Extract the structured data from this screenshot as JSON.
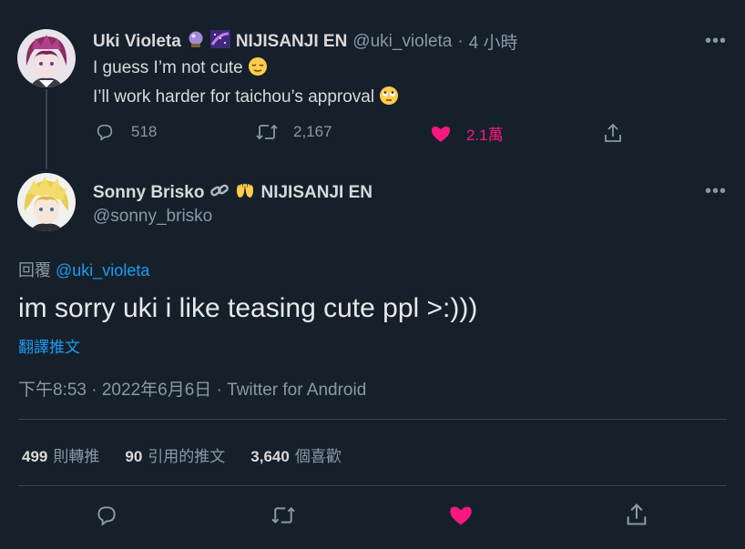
{
  "reply_tweet": {
    "display_name": "Uki Violeta",
    "affiliation": "NIJISANJI EN",
    "handle": "@uki_violeta",
    "time_ago": "4 小時",
    "line1": "I guess I’m not cute",
    "line2": "I’ll work harder for taichou’s approval",
    "reply_count": "518",
    "retweet_count": "2,167",
    "like_count": "2.1萬"
  },
  "main_tweet": {
    "display_name": "Sonny Brisko",
    "affiliation": "NIJISANJI EN",
    "handle": "@sonny_brisko",
    "reply_prefix": "回覆",
    "reply_to": "@uki_violeta",
    "text": "im sorry uki i like teasing cute ppl >:)))",
    "translate": "翻譯推文",
    "timestamp": "下午8:53 · 2022年6月6日 · Twitter for Android"
  },
  "stats": {
    "retweets_num": "499",
    "retweets_label": "則轉推",
    "quotes_num": "90",
    "quotes_label": "引用的推文",
    "likes_num": "3,640",
    "likes_label": "個喜歡"
  },
  "colors": {
    "background": "#15202b",
    "like_pink": "#f91880",
    "link_blue": "#1d9bf0"
  }
}
